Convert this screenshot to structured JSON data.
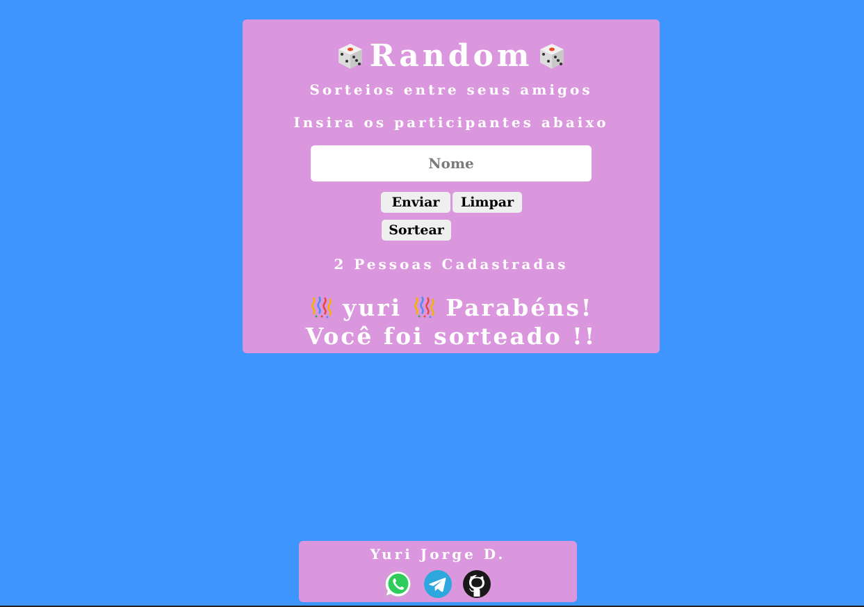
{
  "header": {
    "title": "Random",
    "icon_left": "game-die-icon",
    "icon_right": "game-die-icon"
  },
  "subtitle": "Sorteios entre seus amigos",
  "instructions": "Insira os participantes abaixo",
  "name_input": {
    "placeholder": "Nome",
    "value": ""
  },
  "buttons": {
    "send": "Enviar",
    "clear": "Limpar",
    "draw": "Sortear"
  },
  "registered_count": "2 Pessoas Cadastradas",
  "result": {
    "winner": "yuri",
    "message": "Parabéns! Você foi sorteado !!",
    "icon": "confetti-ball-icon"
  },
  "footer": {
    "author": "Yuri Jorge D.",
    "social": [
      "whatsapp-icon",
      "telegram-icon",
      "github-icon"
    ]
  },
  "colors": {
    "background": "#3e95fd",
    "card": "#db97de",
    "text": "#ffffff",
    "button": "#efefef"
  }
}
